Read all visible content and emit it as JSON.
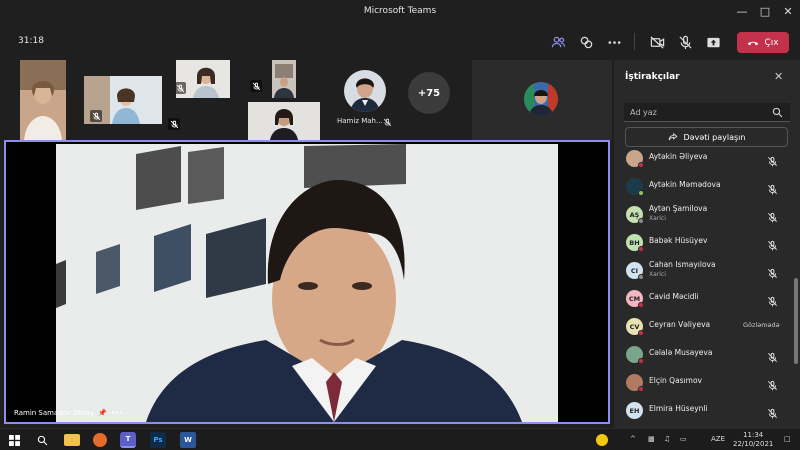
{
  "window": {
    "title": "Microsoft Teams"
  },
  "toolbar": {
    "timer": "31:18",
    "leave_label": "Çıx"
  },
  "gallery": {
    "overflow_count": "+75",
    "tile_names": [
      "Hamiz Mah..."
    ]
  },
  "stage": {
    "speaker_name": "Ramin Samadov Oktay"
  },
  "panel": {
    "title": "İştirakçılar",
    "search_placeholder": "Ad yaz",
    "share_label": "Dəvəti paylaşın",
    "participants": [
      {
        "name": "Aytəkin Əliyeva",
        "initials": "",
        "sub": "",
        "label": ""
      },
      {
        "name": "Aytəkin Məmədova",
        "initials": "",
        "sub": "",
        "label": ""
      },
      {
        "name": "Aytən Şamilova",
        "initials": "AŞ",
        "sub": "Xarici",
        "label": ""
      },
      {
        "name": "Babək Hüsüyev",
        "initials": "BH",
        "sub": "",
        "label": ""
      },
      {
        "name": "Cahan Ismayılova",
        "initials": "CI",
        "sub": "Xarici",
        "label": ""
      },
      {
        "name": "Cavid Məcidli",
        "initials": "CM",
        "sub": "",
        "label": ""
      },
      {
        "name": "Ceyran Vəliyeva",
        "initials": "CV",
        "sub": "",
        "label": "Gözləmədə"
      },
      {
        "name": "Cəlalə Musayeva",
        "initials": "",
        "sub": "",
        "label": ""
      },
      {
        "name": "Elçin Qasımov",
        "initials": "",
        "sub": "",
        "label": ""
      },
      {
        "name": "Elmira Hüseynli",
        "initials": "EH",
        "sub": "",
        "label": ""
      }
    ]
  },
  "taskbar": {
    "lang": "AZE",
    "time": "11:34",
    "date": "22/10/2021"
  },
  "colors": {
    "accent": "#8e8ef0",
    "leave": "#c4314b"
  }
}
